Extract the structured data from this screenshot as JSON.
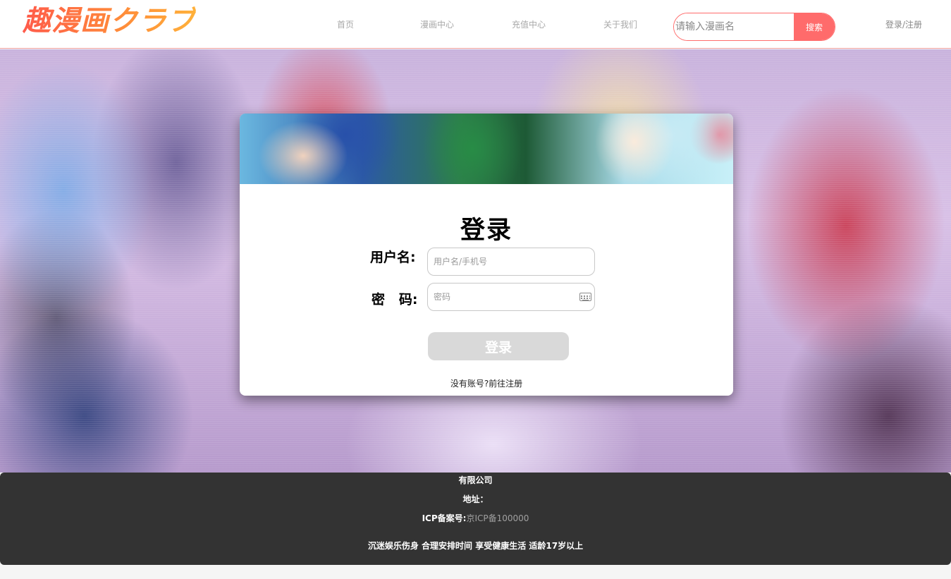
{
  "header": {
    "logo_text": "趣漫画クラブ",
    "nav": [
      "首页",
      "漫画中心",
      "充值中心",
      "关于我们"
    ],
    "search": {
      "placeholder": "请输入漫画名",
      "button": "搜索"
    },
    "login_register": "登录/注册"
  },
  "login": {
    "title": "登录",
    "username_label": "用户名:",
    "username_placeholder": "用户名/手机号",
    "password_label": "密   码:",
    "password_placeholder": "密码",
    "submit": "登录",
    "register_link": "没有账号?前往注册"
  },
  "footer": {
    "company": "有限公司",
    "address": "地址：",
    "icp_label": "ICP备案号:",
    "icp_number": "京ICP备100000",
    "notice": "沉迷娱乐伤身 合理安排时间 享受健康生活 适龄17岁以上"
  },
  "colors": {
    "accent": "#ff6b6b",
    "footer_bg": "#333333",
    "button_disabled": "#d9d9d9"
  },
  "icons": {
    "keyboard": "keyboard-icon"
  }
}
